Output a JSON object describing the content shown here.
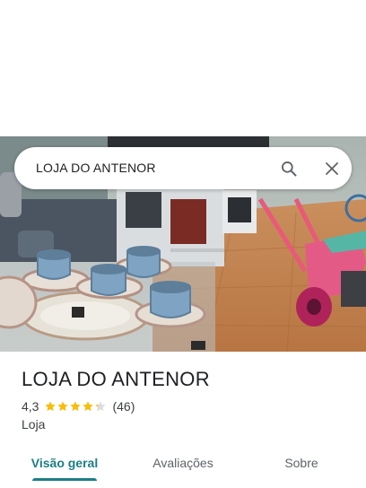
{
  "search": {
    "query": "LOJA DO ANTENOR"
  },
  "place": {
    "name": "LOJA DO ANTENOR",
    "rating": "4,3",
    "rating_fraction": 0.86,
    "reviews": "(46)",
    "category": "Loja"
  },
  "tabs": [
    {
      "label": "Visão geral",
      "active": true
    },
    {
      "label": "Avaliações",
      "active": false
    },
    {
      "label": "Sobre",
      "active": false
    }
  ],
  "colors": {
    "accent": "#1a7f85",
    "star": "#fbbc04"
  },
  "icons": {
    "search": "search-icon",
    "close": "close-icon",
    "star": "star-icon"
  }
}
